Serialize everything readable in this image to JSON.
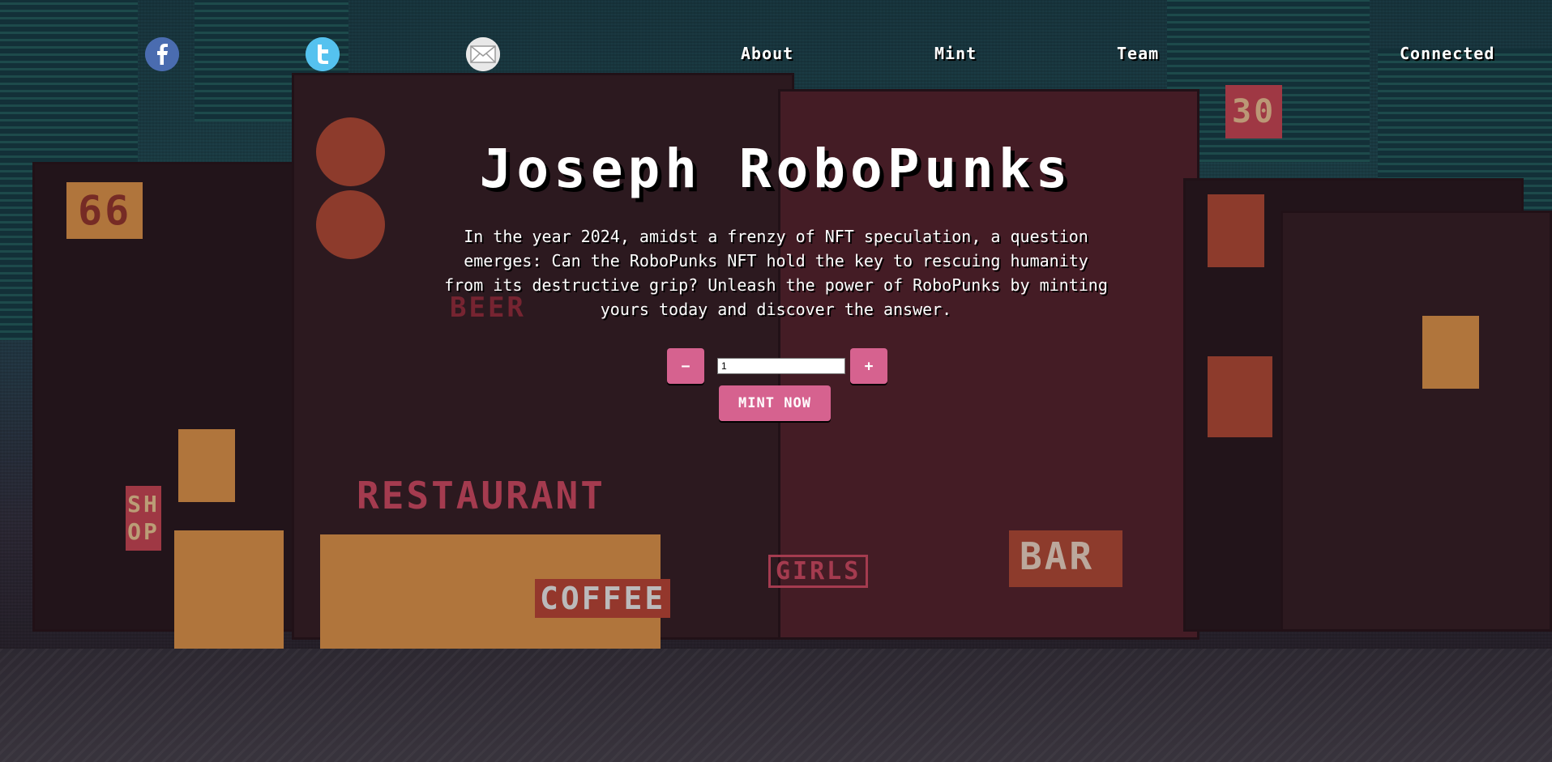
{
  "nav": {
    "social": [
      {
        "name": "facebook-icon",
        "color": "#4a6cb0"
      },
      {
        "name": "twitter-icon",
        "color": "#55c2ef"
      },
      {
        "name": "email-icon",
        "color": "#e8e8e8"
      }
    ],
    "links": [
      "About",
      "Mint",
      "Team"
    ],
    "wallet_status": "Connected"
  },
  "hero": {
    "title": "Joseph RoboPunks",
    "description": "In the year 2024, amidst a frenzy of NFT speculation, a question emerges: Can the RoboPunks NFT hold the key to rescuing humanity from its destructive grip? Unleash the power of RoboPunks by minting yours today and discover the answer."
  },
  "mint": {
    "decrement_label": "−",
    "increment_label": "+",
    "quantity": "1",
    "button_label": "MINT NOW"
  },
  "background_signs": {
    "restaurant": "RESTAURANT",
    "coffee": "COFFEE",
    "bar": "BAR",
    "girls": "GIRLS",
    "shop": "SHOP",
    "beer": "BEER",
    "number_66": "66",
    "number_30": "30"
  },
  "colors": {
    "accent": "#d6628f",
    "text": "#ffffff"
  }
}
